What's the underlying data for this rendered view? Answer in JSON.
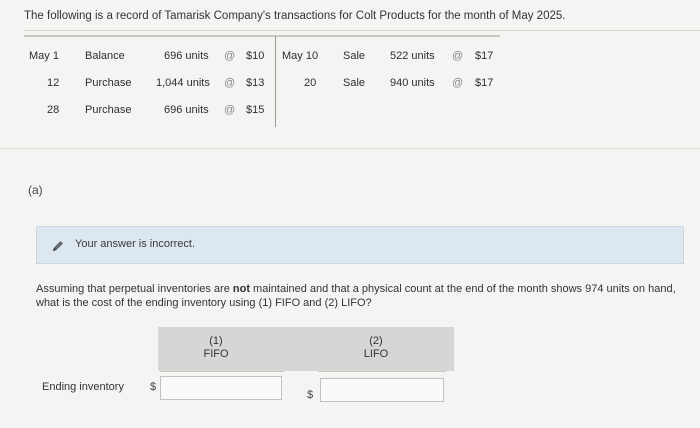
{
  "intro": "The following is a record of Tamarisk Company's transactions for Colt Products for the month of May 2025.",
  "left_rows": [
    {
      "date": "May 1",
      "desc": "Balance",
      "units": "696 units",
      "at": "@",
      "price": "$10"
    },
    {
      "date": "12",
      "desc": "Purchase",
      "units": "1,044 units",
      "at": "@",
      "price": "$13"
    },
    {
      "date": "28",
      "desc": "Purchase",
      "units": "696 units",
      "at": "@",
      "price": "$15"
    }
  ],
  "right_rows": [
    {
      "date": "May 10",
      "desc": "Sale",
      "units": "522 units",
      "at": "@",
      "price": "$17"
    },
    {
      "date": "20",
      "desc": "Sale",
      "units": "940 units",
      "at": "@",
      "price": "$17"
    }
  ],
  "part_label": "(a)",
  "feedback": {
    "message": "Your answer is incorrect.",
    "icon": "pencil-icon"
  },
  "question": {
    "before": "Assuming that perpetual inventories are ",
    "bold": "not",
    "after": " maintained and that a physical count at the end of the month shows 974 units on hand, what is the cost of the ending inventory using (1) FIFO and (2) LIFO?"
  },
  "table": {
    "col1_num": "(1)",
    "col1_name": "FIFO",
    "col2_num": "(2)",
    "col2_name": "LIFO",
    "row_label": "Ending inventory",
    "currency": "$",
    "fifo_value": "",
    "lifo_value": ""
  },
  "colors": {
    "feedback_bg": "#dde7ef",
    "header_band": "#d6d6d4",
    "page_bg": "#f4f4f2"
  }
}
